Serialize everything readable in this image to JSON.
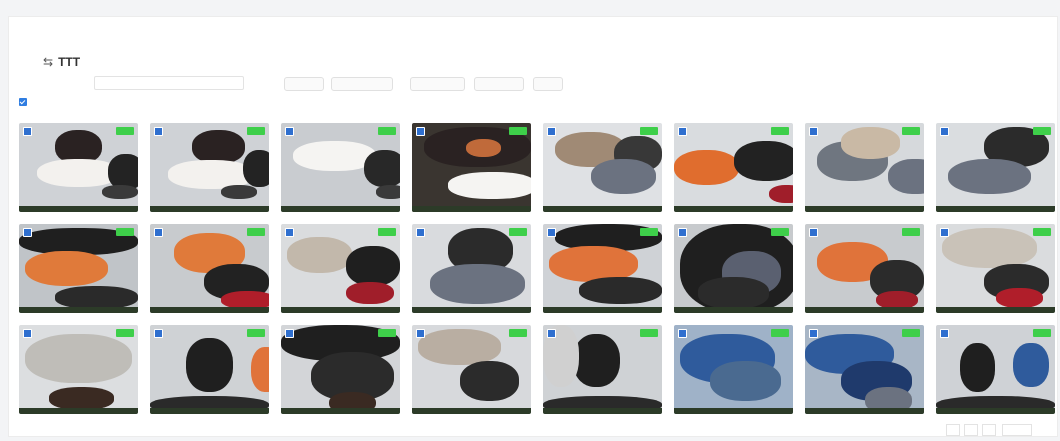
{
  "title": "TTT",
  "icons": {
    "back": "back-arrow-icon",
    "checkbox": "checkbox-icon"
  },
  "colors": {
    "accent": "#2f7de1",
    "badge": "#3ecf4a"
  },
  "grid": {
    "columns": 8,
    "rows": 3
  },
  "cards": [
    {
      "bg": "#cfd2d6",
      "blobs": [
        [
          "#2a2222",
          30,
          8,
          40,
          38
        ],
        [
          "#f3f1ee",
          15,
          40,
          70,
          32
        ],
        [
          "#232323",
          75,
          35,
          30,
          40
        ],
        [
          "#3a3a3a",
          70,
          70,
          30,
          15
        ]
      ]
    },
    {
      "bg": "#cfd2d6",
      "blobs": [
        [
          "#2a2222",
          35,
          8,
          45,
          38
        ],
        [
          "#f3f1ee",
          15,
          42,
          72,
          32
        ],
        [
          "#232323",
          78,
          30,
          28,
          42
        ],
        [
          "#3a3a3a",
          60,
          70,
          30,
          15
        ]
      ]
    },
    {
      "bg": "#c9ccd0",
      "blobs": [
        [
          "#f5f4f2",
          10,
          20,
          70,
          34
        ],
        [
          "#282828",
          70,
          30,
          35,
          42
        ],
        [
          "#3a3a3a",
          80,
          70,
          25,
          15
        ]
      ]
    },
    {
      "bg": "#3a3530",
      "blobs": [
        [
          "#2a2222",
          10,
          5,
          90,
          45
        ],
        [
          "#c06a3a",
          45,
          18,
          30,
          20
        ],
        [
          "#f5f4f2",
          30,
          55,
          75,
          30
        ]
      ]
    },
    {
      "bg": "#dfe1e4",
      "blobs": [
        [
          "#a08a75",
          10,
          10,
          60,
          40
        ],
        [
          "#383838",
          60,
          15,
          40,
          40
        ],
        [
          "#6b7280",
          40,
          40,
          55,
          40
        ]
      ]
    },
    {
      "bg": "#d9dcdf",
      "blobs": [
        [
          "#e06d2e",
          0,
          30,
          55,
          40
        ],
        [
          "#222222",
          50,
          20,
          55,
          45
        ],
        [
          "#a01e2a",
          80,
          70,
          30,
          20
        ]
      ]
    },
    {
      "bg": "#d6d9dc",
      "blobs": [
        [
          "#6f7680",
          10,
          20,
          60,
          45
        ],
        [
          "#c9b9a5",
          30,
          5,
          50,
          35
        ],
        [
          "#6b7280",
          70,
          40,
          45,
          40
        ]
      ]
    },
    {
      "bg": "#dadde0",
      "blobs": [
        [
          "#2b2b2b",
          40,
          5,
          55,
          45
        ],
        [
          "#6b7280",
          10,
          40,
          70,
          40
        ]
      ]
    },
    {
      "bg": "#c0c4c8",
      "blobs": [
        [
          "#1f1f1f",
          0,
          5,
          100,
          30
        ],
        [
          "#e07a3a",
          5,
          30,
          70,
          40
        ],
        [
          "#2a2a2a",
          30,
          70,
          70,
          25
        ]
      ]
    },
    {
      "bg": "#c8cbce",
      "blobs": [
        [
          "#e07a3a",
          20,
          10,
          60,
          45
        ],
        [
          "#222222",
          45,
          45,
          55,
          40
        ],
        [
          "#b01e2a",
          60,
          75,
          45,
          20
        ]
      ]
    },
    {
      "bg": "#dadcde",
      "blobs": [
        [
          "#c2b8ab",
          5,
          15,
          55,
          40
        ],
        [
          "#1f1f1f",
          55,
          25,
          45,
          45
        ],
        [
          "#a01e2a",
          55,
          65,
          40,
          25
        ]
      ]
    },
    {
      "bg": "#d9dbde",
      "blobs": [
        [
          "#2b2b2b",
          30,
          5,
          55,
          50
        ],
        [
          "#6b7280",
          15,
          45,
          80,
          45
        ]
      ]
    },
    {
      "bg": "#cfd2d6",
      "blobs": [
        [
          "#1f1f1f",
          10,
          0,
          90,
          30
        ],
        [
          "#e0733a",
          5,
          25,
          75,
          40
        ],
        [
          "#2a2a2a",
          30,
          60,
          70,
          30
        ]
      ]
    },
    {
      "bg": "#c7cacd",
      "blobs": [
        [
          "#1f1f1f",
          5,
          0,
          100,
          100
        ],
        [
          "#5a6070",
          40,
          30,
          50,
          50
        ],
        [
          "#2b2b2b",
          20,
          60,
          60,
          35
        ]
      ]
    },
    {
      "bg": "#c8cbce",
      "blobs": [
        [
          "#e0733a",
          10,
          20,
          60,
          45
        ],
        [
          "#2b2b2b",
          55,
          40,
          45,
          45
        ],
        [
          "#a01e2a",
          60,
          75,
          35,
          20
        ]
      ]
    },
    {
      "bg": "#dadcde",
      "blobs": [
        [
          "#c9c2b8",
          5,
          5,
          80,
          45
        ],
        [
          "#2b2b2b",
          40,
          45,
          55,
          40
        ],
        [
          "#b01e2a",
          50,
          72,
          40,
          22
        ]
      ]
    },
    {
      "bg": "#dcdee0",
      "blobs": [
        [
          "#bfbdb8",
          5,
          10,
          90,
          55
        ],
        [
          "#3a2a22",
          25,
          70,
          55,
          25
        ]
      ]
    },
    {
      "bg": "#cfd2d5",
      "blobs": [
        [
          "#1f1f1f",
          30,
          15,
          40,
          60
        ],
        [
          "#e0733a",
          85,
          25,
          25,
          50
        ],
        [
          "#2a2a2a",
          0,
          80,
          100,
          20
        ]
      ]
    },
    {
      "bg": "#d3d5d8",
      "blobs": [
        [
          "#1f1f1f",
          0,
          0,
          100,
          40
        ],
        [
          "#2b2b2b",
          25,
          30,
          70,
          55
        ],
        [
          "#3a2a22",
          40,
          75,
          40,
          25
        ]
      ]
    },
    {
      "bg": "#d7d9dc",
      "blobs": [
        [
          "#b9aea2",
          5,
          5,
          70,
          40
        ],
        [
          "#2b2b2b",
          40,
          40,
          50,
          45
        ]
      ]
    },
    {
      "bg": "#cfd2d5",
      "blobs": [
        [
          "#1f1f1f",
          25,
          10,
          40,
          60
        ],
        [
          "#d0d0d0",
          0,
          0,
          30,
          70
        ],
        [
          "#2a2a2a",
          0,
          80,
          100,
          20
        ]
      ]
    },
    {
      "bg": "#9fb2c8",
      "blobs": [
        [
          "#2f5b9c",
          5,
          10,
          80,
          55
        ],
        [
          "#4a6a90",
          30,
          40,
          60,
          45
        ]
      ]
    },
    {
      "bg": "#a8b6c6",
      "blobs": [
        [
          "#2f5b9c",
          0,
          10,
          75,
          45
        ],
        [
          "#1f3a6c",
          30,
          40,
          60,
          45
        ],
        [
          "#6b7280",
          50,
          70,
          40,
          30
        ]
      ]
    },
    {
      "bg": "#cfd2d6",
      "blobs": [
        [
          "#1f1f1f",
          20,
          20,
          30,
          55
        ],
        [
          "#2f5b9c",
          65,
          20,
          30,
          50
        ],
        [
          "#2a2a2a",
          0,
          80,
          100,
          20
        ]
      ]
    }
  ]
}
